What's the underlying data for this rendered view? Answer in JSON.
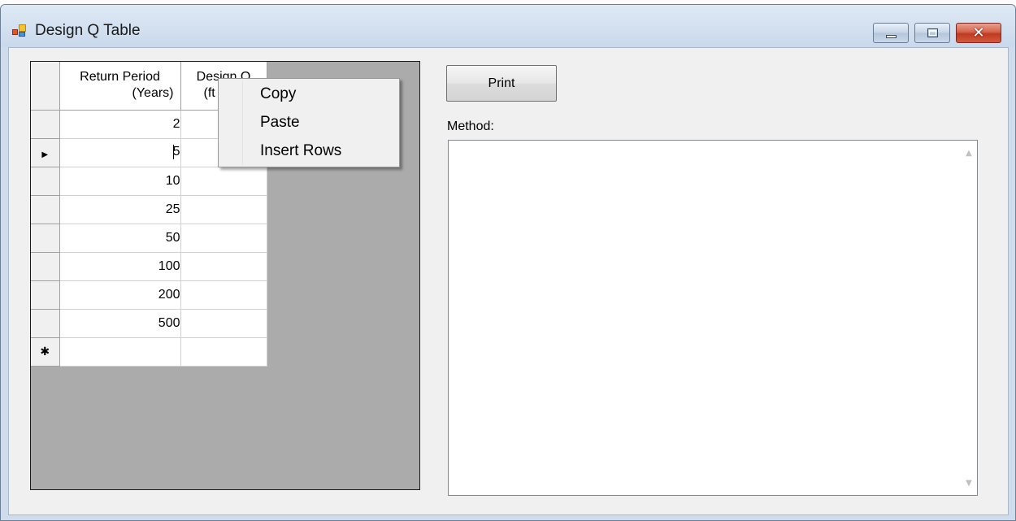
{
  "window": {
    "title": "Design Q Table",
    "controls": {
      "minimize": "minimize-icon",
      "maximize": "maximize-icon",
      "close_glyph": "✕"
    }
  },
  "grid": {
    "columns": [
      "Return Period\n(Years)",
      "Design Q\n(ft"
    ],
    "col1_line1": "Return Period",
    "col1_line2": "(Years)",
    "col2_line1": "Design Q",
    "col2_line2": "(ft",
    "current_row_marker": "▶",
    "new_row_marker": "✱",
    "rows": [
      {
        "return_period": "2",
        "design_q": ""
      },
      {
        "return_period": "5",
        "design_q": ""
      },
      {
        "return_period": "10",
        "design_q": ""
      },
      {
        "return_period": "25",
        "design_q": ""
      },
      {
        "return_period": "50",
        "design_q": ""
      },
      {
        "return_period": "100",
        "design_q": ""
      },
      {
        "return_period": "200",
        "design_q": ""
      },
      {
        "return_period": "500",
        "design_q": ""
      },
      {
        "return_period": "",
        "design_q": ""
      }
    ]
  },
  "context_menu": {
    "items": [
      "Copy",
      "Paste",
      "Insert Rows"
    ]
  },
  "print_button": {
    "label": "Print"
  },
  "method": {
    "label": "Method:",
    "value": "",
    "scroll_up": "▲",
    "scroll_down": "▼"
  }
}
